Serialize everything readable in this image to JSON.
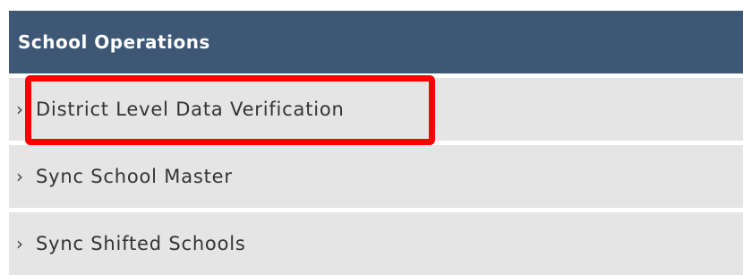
{
  "panel": {
    "title": "School Operations",
    "items": [
      {
        "label": "District Level Data Verification",
        "chevron": "›",
        "highlighted": true
      },
      {
        "label": "Sync School Master",
        "chevron": "›",
        "highlighted": false
      },
      {
        "label": "Sync Shifted Schools",
        "chevron": "›",
        "highlighted": false
      }
    ]
  },
  "colors": {
    "header_bg": "#3d5775",
    "item_bg": "#e5e5e5",
    "highlight": "#ff0000"
  }
}
